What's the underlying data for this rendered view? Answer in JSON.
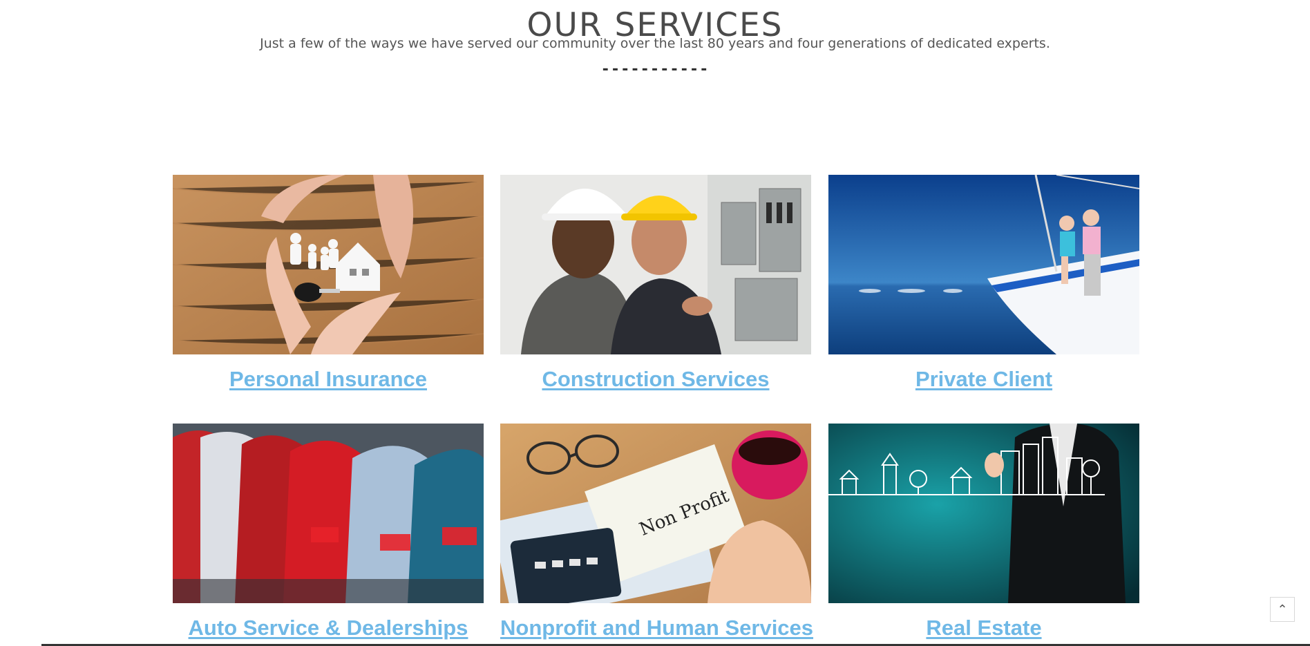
{
  "header": {
    "title": "OUR SERVICES",
    "subtitle": "Just a few of the ways we have served our community over the last 80 years and four generations of dedicated experts.",
    "divider": "-----------"
  },
  "services": [
    {
      "label": "Personal Insurance"
    },
    {
      "label": "Construction Services"
    },
    {
      "label": "Private Client"
    },
    {
      "label": "Auto Service & Dealerships"
    },
    {
      "label": "Nonprofit and Human Services"
    },
    {
      "label": "Real Estate"
    }
  ],
  "notepad_text": "Non Profit",
  "scroll_top": {
    "icon": "chevron-up-icon",
    "glyph": "⌃"
  },
  "colors": {
    "link": "#6fb8e6",
    "title": "#4a4a4a"
  }
}
